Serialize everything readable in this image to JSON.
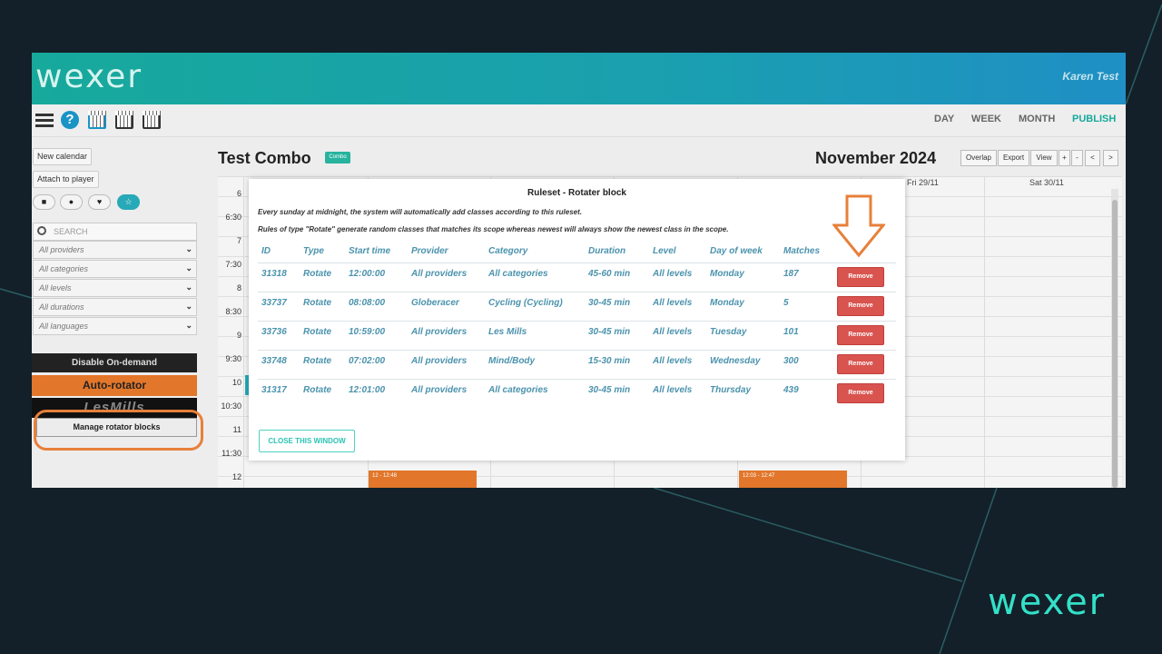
{
  "slide": {
    "logo": "wexer"
  },
  "app": {
    "brand": "wexer",
    "user": "Karen Test"
  },
  "toolbar": {
    "views": [
      "DAY",
      "WEEK",
      "MONTH",
      "PUBLISH"
    ]
  },
  "sidebar": {
    "new_calendar": "New calendar",
    "attach_to_player": "Attach to player",
    "search_placeholder": "SEARCH",
    "filters": [
      "All providers",
      "All categories",
      "All levels",
      "All durations",
      "All languages"
    ],
    "disable_on_demand": "Disable On-demand",
    "auto_rotator": "Auto-rotator",
    "lesmills": "LesMills",
    "manage_rotator_blocks": "Manage rotator blocks"
  },
  "calendar": {
    "title": "Test Combo",
    "badge": "Combo",
    "month": "November 2024",
    "buttons": [
      "Overlap",
      "Export",
      "View",
      "+",
      "-",
      "<",
      ">"
    ],
    "day_headers": [
      "Fri 29/11",
      "Sat 30/11"
    ],
    "hours": [
      "6",
      "6:30",
      "7",
      "7:30",
      "8",
      "8:30",
      "9",
      "9:30",
      "10",
      "10:30",
      "11",
      "11:30",
      "12"
    ],
    "events": [
      "12 - 12:48",
      "12:03 - 12:47"
    ]
  },
  "modal": {
    "title": "Ruleset - Rotater block",
    "desc1": "Every sunday at midnight, the system will automatically add classes according to this ruleset.",
    "desc2": "Rules of type \"Rotate\" generate random classes that matches its scope whereas newest will always show the newest class in the scope.",
    "columns": [
      "ID",
      "Type",
      "Start time",
      "Provider",
      "Category",
      "Duration",
      "Level",
      "Day of week",
      "Matches"
    ],
    "rows": [
      [
        "31318",
        "Rotate",
        "12:00:00",
        "All providers",
        "All categories",
        "45-60 min",
        "All levels",
        "Monday",
        "187"
      ],
      [
        "33737",
        "Rotate",
        "08:08:00",
        "Globeracer",
        "Cycling (Cycling)",
        "30-45 min",
        "All levels",
        "Monday",
        "5"
      ],
      [
        "33736",
        "Rotate",
        "10:59:00",
        "All providers",
        "Les Mills",
        "30-45 min",
        "All levels",
        "Tuesday",
        "101"
      ],
      [
        "33748",
        "Rotate",
        "07:02:00",
        "All providers",
        "Mind/Body",
        "15-30 min",
        "All levels",
        "Wednesday",
        "300"
      ],
      [
        "31317",
        "Rotate",
        "12:01:00",
        "All providers",
        "All categories",
        "30-45 min",
        "All levels",
        "Thursday",
        "439"
      ]
    ],
    "remove_label": "Remove",
    "close_label": "CLOSE THIS WINDOW"
  },
  "colors": {
    "accent": "#17a99c",
    "orange": "#e7803a",
    "danger": "#d9534f",
    "slide_bg": "#132029"
  }
}
